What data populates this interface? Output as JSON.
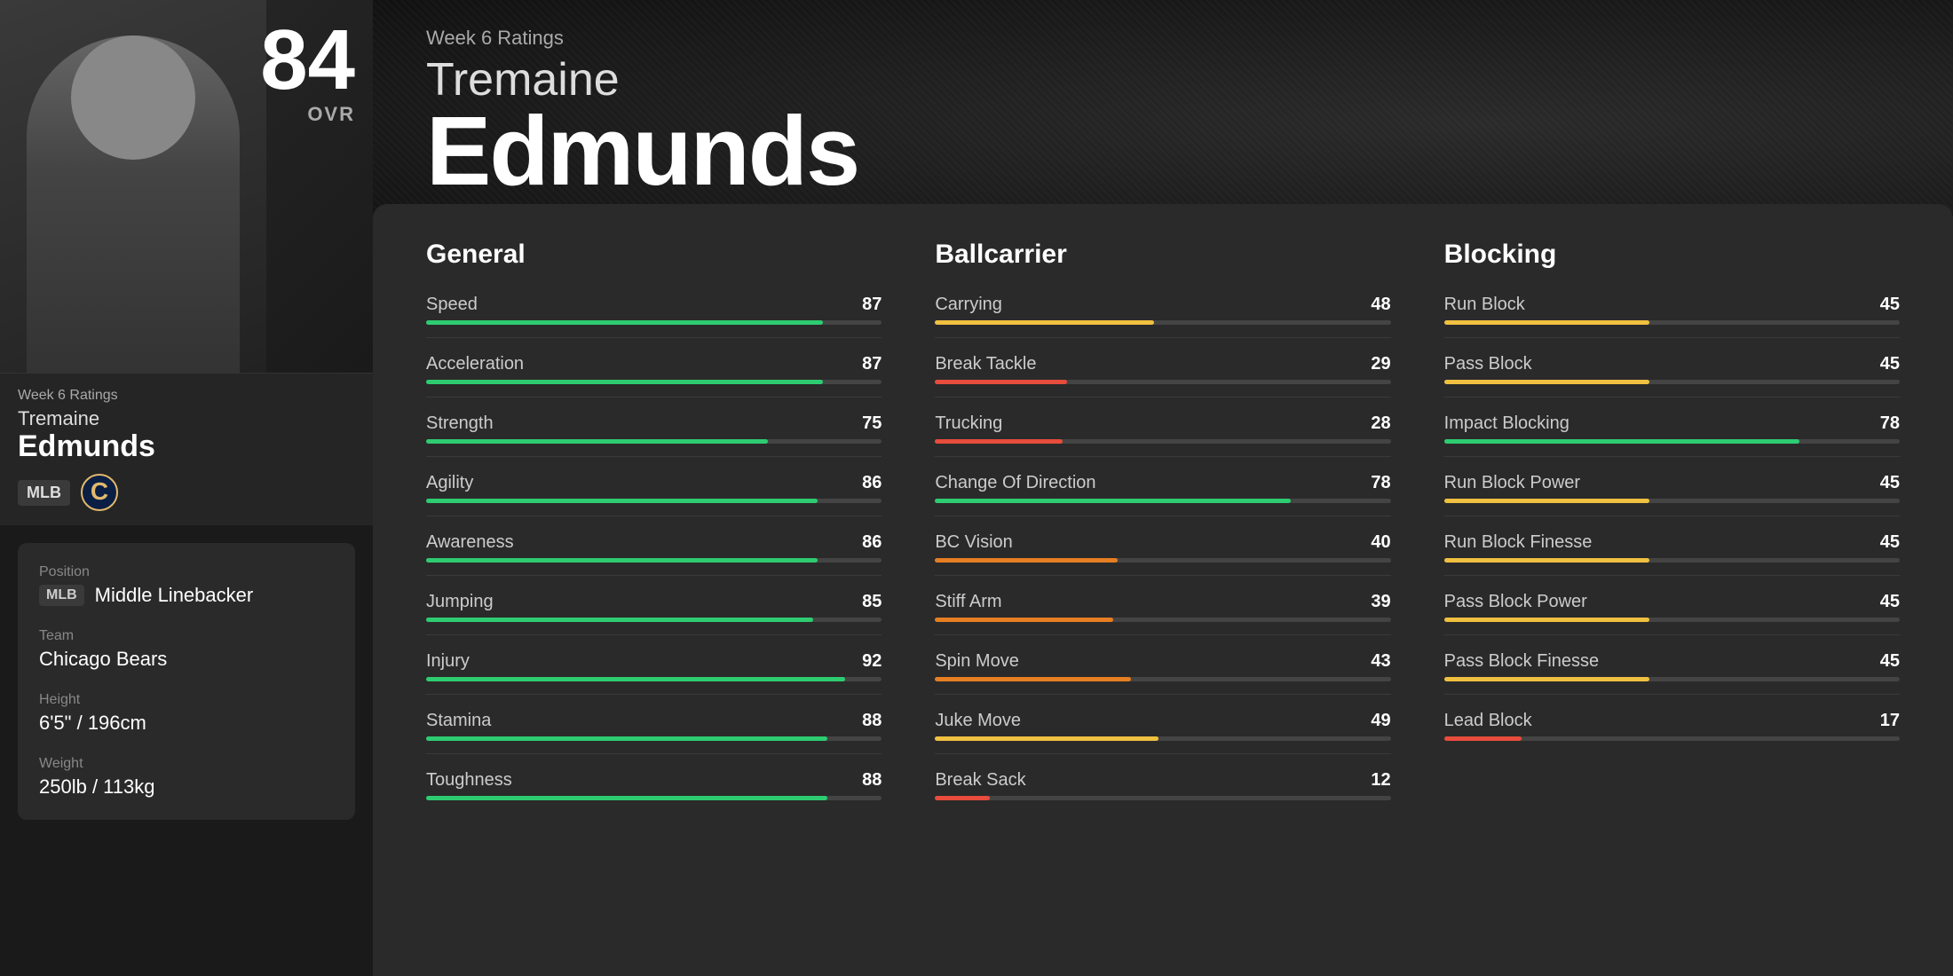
{
  "player": {
    "week_label": "Week 6 Ratings",
    "firstname": "Tremaine",
    "lastname": "Edmunds",
    "ovr": "84",
    "ovr_label": "OVR",
    "position": "MLB",
    "position_full": "Middle Linebacker",
    "team": "Chicago Bears"
  },
  "info": {
    "position_label": "Position",
    "position_badge": "MLB",
    "position_full": "Middle Linebacker",
    "team_label": "Team",
    "team_name": "Chicago Bears",
    "height_label": "Height",
    "height_value": "6'5\" / 196cm",
    "weight_label": "Weight",
    "weight_value": "250lb / 113kg"
  },
  "stats": {
    "general_title": "General",
    "ballcarrier_title": "Ballcarrier",
    "blocking_title": "Blocking",
    "general": [
      {
        "name": "Speed",
        "value": 87
      },
      {
        "name": "Acceleration",
        "value": 87
      },
      {
        "name": "Strength",
        "value": 75
      },
      {
        "name": "Agility",
        "value": 86
      },
      {
        "name": "Awareness",
        "value": 86
      },
      {
        "name": "Jumping",
        "value": 85
      },
      {
        "name": "Injury",
        "value": 92
      },
      {
        "name": "Stamina",
        "value": 88
      },
      {
        "name": "Toughness",
        "value": 88
      }
    ],
    "ballcarrier": [
      {
        "name": "Carrying",
        "value": 48
      },
      {
        "name": "Break Tackle",
        "value": 29
      },
      {
        "name": "Trucking",
        "value": 28
      },
      {
        "name": "Change Of Direction",
        "value": 78
      },
      {
        "name": "BC Vision",
        "value": 40
      },
      {
        "name": "Stiff Arm",
        "value": 39
      },
      {
        "name": "Spin Move",
        "value": 43
      },
      {
        "name": "Juke Move",
        "value": 49
      },
      {
        "name": "Break Sack",
        "value": 12
      }
    ],
    "blocking": [
      {
        "name": "Run Block",
        "value": 45
      },
      {
        "name": "Pass Block",
        "value": 45
      },
      {
        "name": "Impact Blocking",
        "value": 78
      },
      {
        "name": "Run Block Power",
        "value": 45
      },
      {
        "name": "Run Block Finesse",
        "value": 45
      },
      {
        "name": "Pass Block Power",
        "value": 45
      },
      {
        "name": "Pass Block Finesse",
        "value": 45
      },
      {
        "name": "Lead Block",
        "value": 17
      }
    ]
  }
}
